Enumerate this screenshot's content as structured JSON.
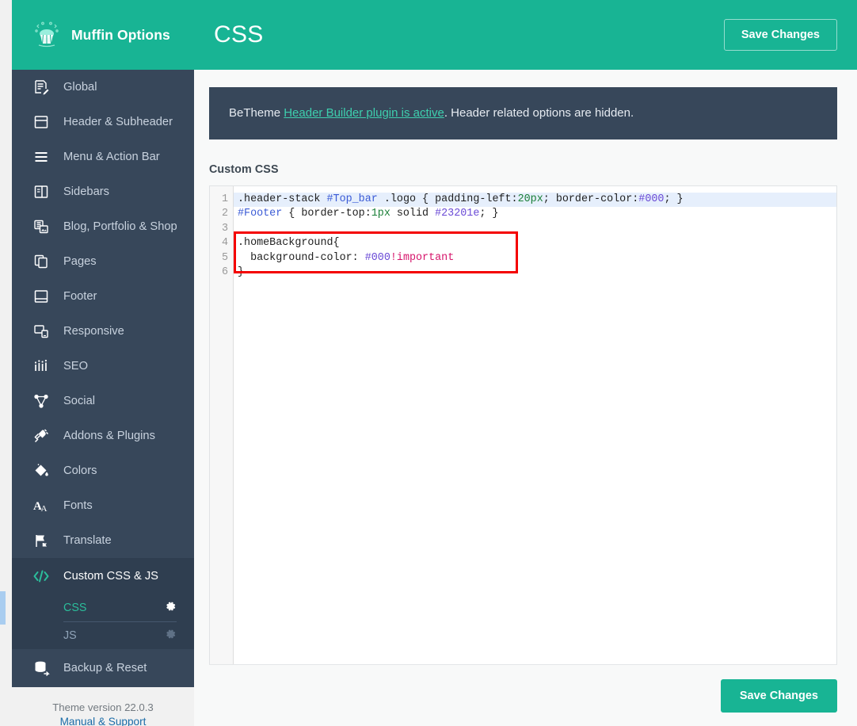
{
  "brand": {
    "title": "Muffin Options",
    "logo_icon": "muffin-icon",
    "bg_color": "#18b494"
  },
  "header": {
    "title": "CSS",
    "save_label": "Save Changes"
  },
  "sidebar": {
    "items": [
      {
        "label": "Global",
        "icon": "document-edit-icon"
      },
      {
        "label": "Header & Subheader",
        "icon": "window-header-icon"
      },
      {
        "label": "Menu & Action Bar",
        "icon": "hamburger-menu-icon"
      },
      {
        "label": "Sidebars",
        "icon": "sidebar-layout-icon"
      },
      {
        "label": "Blog, Portfolio & Shop",
        "icon": "blog-grid-icon"
      },
      {
        "label": "Pages",
        "icon": "copy-pages-icon"
      },
      {
        "label": "Footer",
        "icon": "window-footer-icon"
      },
      {
        "label": "Responsive",
        "icon": "responsive-devices-icon"
      },
      {
        "label": "SEO",
        "icon": "bar-chart-icon"
      },
      {
        "label": "Social",
        "icon": "social-network-icon"
      },
      {
        "label": "Addons & Plugins",
        "icon": "plug-icon"
      },
      {
        "label": "Colors",
        "icon": "paint-bucket-icon"
      },
      {
        "label": "Fonts",
        "icon": "font-letters-icon"
      },
      {
        "label": "Translate",
        "icon": "flag-icon"
      }
    ],
    "group": {
      "label": "Custom CSS & JS",
      "icon": "code-brackets-icon",
      "children": [
        {
          "label": "CSS",
          "active": true,
          "gear_icon": "gear-icon"
        },
        {
          "label": "JS",
          "active": false,
          "gear_icon": "gear-icon"
        }
      ]
    },
    "backup": {
      "label": "Backup & Reset",
      "icon": "database-reset-icon"
    },
    "footer": {
      "version": "Theme version 22.0.3",
      "manual_link": "Manual & Support"
    },
    "active_accent_color": "#a9cdf0",
    "active_text_color": "#2bbd9b"
  },
  "notice": {
    "prefix": "BeTheme ",
    "link": "Header Builder plugin is active",
    "suffix": ". Header related options are hidden.",
    "bg_color": "#37475a"
  },
  "main": {
    "field_label": "Custom CSS",
    "save_label": "Save Changes"
  },
  "editor": {
    "line_numbers": [
      "1",
      "2",
      "3",
      "4",
      "5",
      "6"
    ],
    "active_line": 1,
    "highlight_box": {
      "color": "#f40000",
      "lines": [
        4,
        6
      ]
    },
    "lines": [
      {
        "n": 1,
        "text": ".header-stack #Top_bar .logo { padding-left:20px; border-color:#000; }"
      },
      {
        "n": 2,
        "text": "#Footer { border-top:1px solid #23201e; }"
      },
      {
        "n": 3,
        "text": ""
      },
      {
        "n": 4,
        "text": ".homeBackground{"
      },
      {
        "n": 5,
        "text": "  background-color: #000!important"
      },
      {
        "n": 6,
        "text": "}"
      }
    ],
    "tokens": {
      "l1": [
        {
          "t": ".header-stack ",
          "c": "sel"
        },
        {
          "t": "#Top_bar",
          "c": "id"
        },
        {
          "t": " .logo { padding-left:",
          "c": "plain"
        },
        {
          "t": "20px",
          "c": "num"
        },
        {
          "t": "; border-color:",
          "c": "plain"
        },
        {
          "t": "#000",
          "c": "hex"
        },
        {
          "t": "; }",
          "c": "plain"
        }
      ],
      "l2": [
        {
          "t": "#Footer",
          "c": "id"
        },
        {
          "t": " { border-top:",
          "c": "plain"
        },
        {
          "t": "1px",
          "c": "num"
        },
        {
          "t": " solid ",
          "c": "plain"
        },
        {
          "t": "#23201e",
          "c": "hex"
        },
        {
          "t": "; }",
          "c": "plain"
        }
      ],
      "l3": [],
      "l4": [
        {
          "t": ".homeBackground{",
          "c": "sel"
        }
      ],
      "l5": [
        {
          "t": "  background-color: ",
          "c": "plain"
        },
        {
          "t": "#000",
          "c": "hex"
        },
        {
          "t": "!important",
          "c": "imp"
        }
      ],
      "l6": [
        {
          "t": "}",
          "c": "plain"
        }
      ]
    }
  }
}
